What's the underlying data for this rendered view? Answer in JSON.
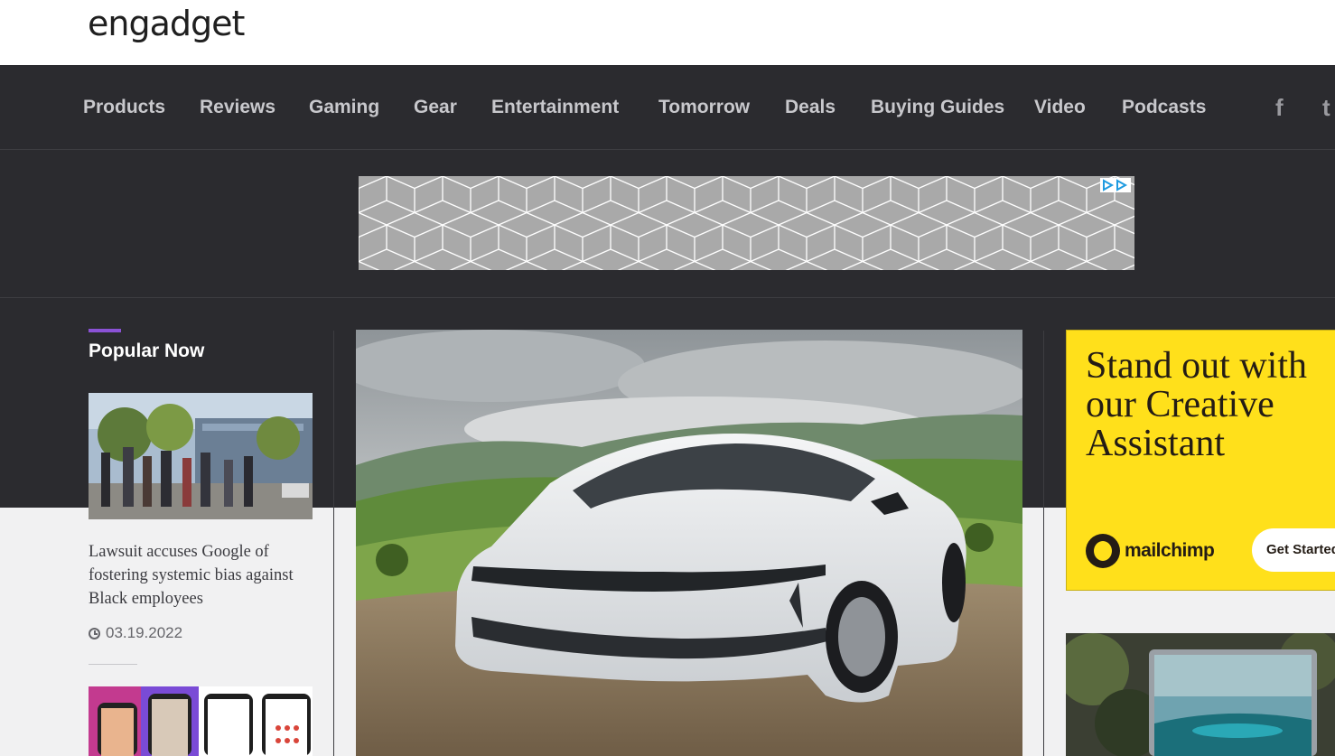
{
  "logo": {
    "text": "engadget"
  },
  "nav": {
    "items": [
      {
        "label": "Products"
      },
      {
        "label": "Reviews"
      },
      {
        "label": "Gaming"
      },
      {
        "label": "Gear"
      },
      {
        "label": "Entertainment"
      },
      {
        "label": "Tomorrow"
      },
      {
        "label": "Deals"
      },
      {
        "label": "Buying Guides"
      },
      {
        "label": "Video"
      },
      {
        "label": "Podcasts"
      }
    ],
    "social": [
      {
        "glyph": "f",
        "icon": "facebook-icon"
      },
      {
        "glyph": "t",
        "icon": "twitter-icon"
      }
    ]
  },
  "popular": {
    "title": "Popular Now",
    "articles": [
      {
        "title": "Lawsuit accuses Google of fostering systemic bias against Black employees",
        "date": "03.19.2022"
      }
    ]
  },
  "side_ad": {
    "headline": "Stand out with our Creative Assistant",
    "brand": "mailchimp",
    "cta": "Get Started"
  },
  "colors": {
    "nav_background": "#2b2b2f",
    "accent": "#8b52d6",
    "ad_yellow": "#ffe01b"
  }
}
